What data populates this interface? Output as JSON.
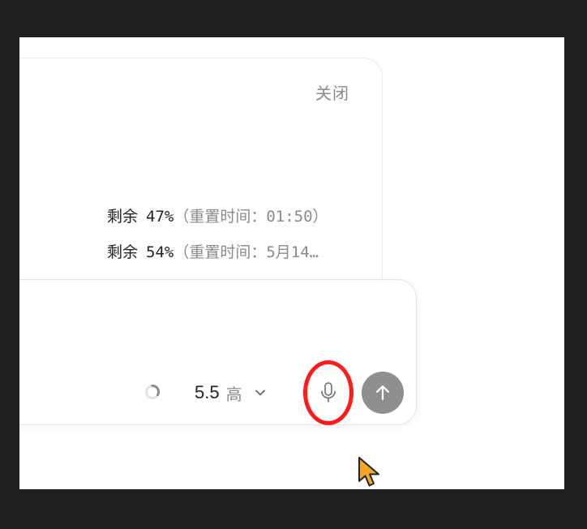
{
  "popover": {
    "close_label": "关闭",
    "usage": [
      {
        "prefix": "剩余",
        "percent": "47%",
        "reset": "（重置时间：01:50）"
      },
      {
        "prefix": "剩余",
        "percent": "54%",
        "reset": "（重置时间：5月14…"
      }
    ]
  },
  "composer": {
    "model_version": "5.5",
    "model_effort": "高",
    "mic_icon": "microphone-icon",
    "send_icon": "arrow-up-icon",
    "accent_colors": {
      "highlight": "#ff1a1a",
      "send_button": "#8f8f8f",
      "cursor": "#f5a623"
    }
  }
}
